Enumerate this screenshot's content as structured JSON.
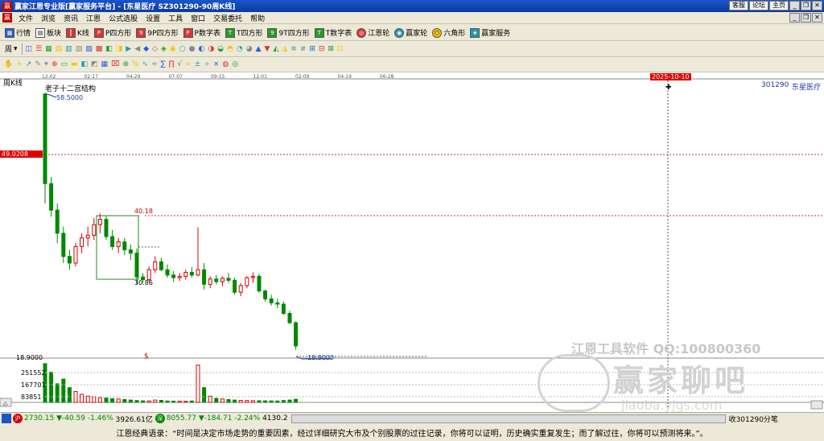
{
  "window": {
    "title": "赢家江恩专业版[赢家服务平台] - [东星医疗   SZ301290-90周K线]",
    "links": [
      "客服",
      "论坛",
      "主页"
    ]
  },
  "menu": [
    "文件",
    "浏览",
    "资讯",
    "江恩",
    "公式选股",
    "设置",
    "工具",
    "窗口",
    "交易委托",
    "帮助"
  ],
  "toolbar1": [
    {
      "icon": "grid-icon",
      "label": "行情"
    },
    {
      "icon": "blocks-icon",
      "label": "板块"
    },
    {
      "icon": "candlestick-icon",
      "label": "K线"
    },
    {
      "icon": "p-square-icon",
      "label": "P四方形"
    },
    {
      "icon": "9p-square-icon",
      "label": "9P四方形"
    },
    {
      "icon": "p-number-icon",
      "label": "P数字表"
    },
    {
      "icon": "t-square-icon",
      "label": "T四方形"
    },
    {
      "icon": "9t-square-icon",
      "label": "9T四方形"
    },
    {
      "icon": "t-number-icon",
      "label": "T数字表"
    },
    {
      "icon": "gann-wheel-icon",
      "label": "江恩轮"
    },
    {
      "icon": "winner-wheel-icon",
      "label": "赢家轮"
    },
    {
      "icon": "hexagon-icon",
      "label": "六角形"
    },
    {
      "icon": "service-icon",
      "label": "赢家服务"
    }
  ],
  "toolbar2_left_label": "周",
  "chart": {
    "period_label": "周K线",
    "stock_code": "301290",
    "stock_name": "东星医疗",
    "structure_label": "老子十二宫结构",
    "date_axis": [
      "12-02",
      "02-17",
      "04-29",
      "07-07",
      "09-15",
      "12-01",
      "02-09",
      "04-19",
      "06-28"
    ],
    "cursor_date": "2025-10-10",
    "cursor_price": "49.0208",
    "high_label": "58.5000",
    "box_top_label": "40.18",
    "box_bottom_label": "30.86",
    "low_label": "18.9000",
    "low_marker_label": "19.9000",
    "volume_axis": [
      "251552",
      "167701",
      "83851"
    ],
    "watermark_line1": "江恩工具软件   QQ:100800360",
    "watermark_line2": "赢家聊吧",
    "watermark_line3": "jiaoba.yjgs.com",
    "colors": {
      "up": "#d40000",
      "down": "#008800",
      "box": "#228822",
      "cursor_price_bg": "#e00000"
    }
  },
  "chart_data": {
    "type": "candlestick",
    "title": "老子十二宫结构",
    "ylim": [
      18.9,
      58.5
    ],
    "series": [
      {
        "name": "price",
        "ohlc": [
          [
            58.5,
            58.5,
            42.0,
            45.0
          ],
          [
            45.0,
            46.0,
            40.0,
            41.0
          ],
          [
            41.0,
            42.0,
            36.0,
            37.5
          ],
          [
            37.5,
            38.5,
            33.0,
            34.0
          ],
          [
            34.0,
            35.0,
            32.0,
            33.0
          ],
          [
            33.0,
            36.0,
            32.5,
            35.5
          ],
          [
            35.5,
            37.5,
            34.5,
            36.8
          ],
          [
            36.8,
            38.5,
            35.5,
            37.2
          ],
          [
            37.2,
            39.8,
            36.5,
            38.8
          ],
          [
            38.8,
            40.5,
            37.5,
            39.6
          ],
          [
            39.6,
            40.2,
            36.5,
            37.0
          ],
          [
            37.0,
            38.0,
            35.0,
            35.5
          ],
          [
            35.5,
            36.8,
            34.5,
            36.2
          ],
          [
            36.2,
            36.8,
            34.2,
            35.0
          ],
          [
            35.0,
            35.8,
            33.5,
            34.5
          ],
          [
            34.5,
            35.2,
            29.8,
            30.9
          ],
          [
            30.9,
            31.5,
            30.0,
            30.5
          ],
          [
            30.5,
            32.5,
            30.2,
            32.0
          ],
          [
            32.0,
            34.0,
            31.5,
            33.2
          ],
          [
            33.2,
            33.8,
            31.8,
            32.0
          ],
          [
            32.0,
            32.8,
            30.8,
            31.2
          ],
          [
            31.2,
            31.8,
            30.2,
            30.8
          ],
          [
            30.8,
            31.5,
            30.3,
            31.0
          ],
          [
            31.0,
            32.0,
            30.5,
            31.6
          ],
          [
            31.6,
            32.4,
            30.8,
            31.2
          ],
          [
            31.2,
            38.4,
            31.0,
            32.0
          ],
          [
            32.0,
            33.0,
            29.0,
            29.8
          ],
          [
            29.8,
            31.0,
            29.2,
            30.6
          ],
          [
            30.6,
            31.2,
            29.8,
            30.2
          ],
          [
            30.2,
            31.0,
            29.5,
            30.7
          ],
          [
            30.7,
            31.5,
            30.0,
            30.4
          ],
          [
            30.4,
            30.8,
            28.2,
            28.6
          ],
          [
            28.6,
            30.0,
            28.0,
            29.6
          ],
          [
            29.6,
            31.0,
            29.2,
            30.8
          ],
          [
            30.8,
            31.6,
            30.0,
            31.0
          ],
          [
            31.0,
            31.4,
            28.5,
            28.8
          ],
          [
            28.8,
            29.0,
            27.2,
            27.6
          ],
          [
            27.6,
            28.2,
            26.6,
            27.0
          ],
          [
            27.0,
            27.6,
            26.2,
            26.8
          ],
          [
            26.8,
            27.2,
            25.2,
            25.4
          ],
          [
            25.4,
            25.8,
            23.8,
            24.0
          ],
          [
            24.0,
            24.2,
            19.9,
            20.5
          ]
        ]
      },
      {
        "name": "volume",
        "values": [
          250000,
          195000,
          120000,
          150000,
          95000,
          70000,
          52000,
          40000,
          36000,
          30000,
          28000,
          24000,
          22000,
          18000,
          15000,
          12000,
          10000,
          9000,
          15000,
          13000,
          9000,
          8000,
          7500,
          6800,
          9000,
          240000,
          95000,
          40000,
          26000,
          22000,
          18000,
          15000,
          13000,
          12000,
          11000,
          10500,
          10000,
          9500,
          9000,
          12000,
          15000,
          20000
        ]
      }
    ]
  },
  "status": {
    "sh_index": "2730.15",
    "sh_change": "▼-40.59",
    "sh_pct": "-1.46%",
    "sh_amount": "3926.61亿",
    "sz_index": "8055.77",
    "sz_change": "▼-184.71",
    "sz_pct": "-2.24%",
    "sz_amount": "4130.2",
    "right_label": "收301290分笔"
  },
  "footer": {
    "quote": "江恩经典语录：“时间是决定市场走势的重要因素，经过详细研究大市及个别股票的过往记录，你将可以证明，历史确实重复发生；而了解过往，你将可以预测将来。”。"
  }
}
